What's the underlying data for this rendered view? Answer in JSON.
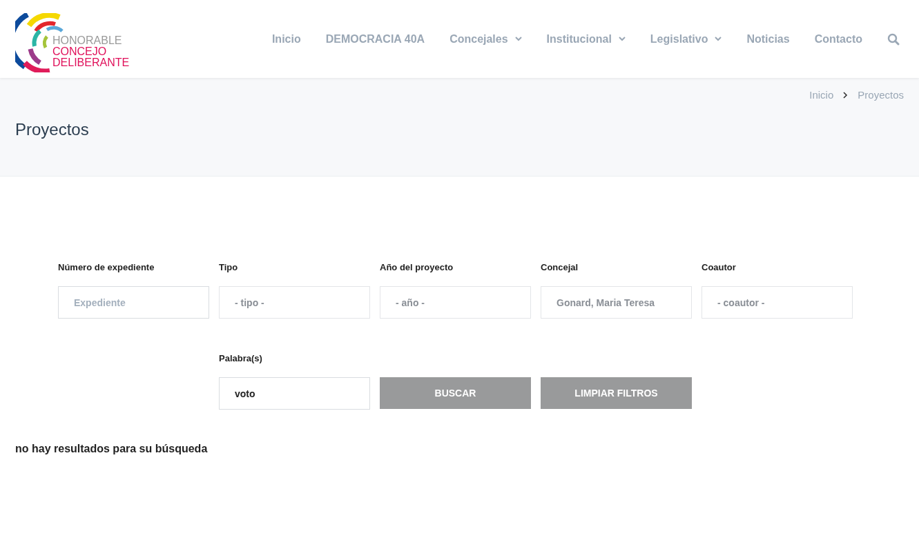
{
  "logo": {
    "line_1": "HONORABLE",
    "line_2": "CONCEJO",
    "line_3": "DELIBERANTE"
  },
  "nav": [
    {
      "label": "Inicio",
      "dropdown": false
    },
    {
      "label": "DEMOCRACIA 40A",
      "dropdown": false
    },
    {
      "label": "Concejales",
      "dropdown": true
    },
    {
      "label": "Institucional",
      "dropdown": true
    },
    {
      "label": "Legislativo",
      "dropdown": true
    },
    {
      "label": "Noticias",
      "dropdown": false
    },
    {
      "label": "Contacto",
      "dropdown": false
    }
  ],
  "breadcrumb": [
    "Inicio",
    "Proyectos"
  ],
  "page_title": "Proyectos",
  "filters": [
    {
      "label": "Número de expediente",
      "kind": "input",
      "placeholder": "Expediente"
    },
    {
      "label": "Tipo",
      "kind": "select",
      "value": "- tipo -"
    },
    {
      "label": "Año del proyecto",
      "kind": "select",
      "value": "- año -"
    },
    {
      "label": "Concejal",
      "kind": "select",
      "value": "Gonard, Maria Teresa"
    },
    {
      "label": "Coautor",
      "kind": "select",
      "value": "- coautor -"
    }
  ],
  "keywords": {
    "label": "Palabra(s)",
    "value": "voto"
  },
  "buttons": [
    "BUSCAR",
    "LIMPIAR FILTROS"
  ],
  "result_message": "no hay resultados para su búsqueda"
}
